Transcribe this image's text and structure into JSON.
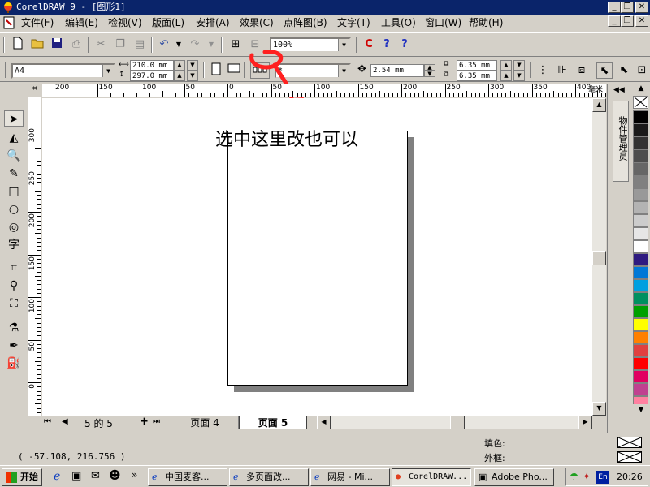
{
  "window": {
    "title": "CorelDRAW 9 - [图形1]",
    "min_glyph": "_",
    "restore_glyph": "❐",
    "close_glyph": "✕"
  },
  "menu": [
    "文件(F)",
    "编辑(E)",
    "检视(V)",
    "版面(L)",
    "安排(A)",
    "效果(C)",
    "点阵图(B)",
    "文字(T)",
    "工具(O)",
    "窗口(W)",
    "帮助(H)"
  ],
  "standard_toolbar": {
    "zoom": "100%",
    "icons": [
      "new-icon",
      "open-icon",
      "save-icon",
      "print-icon",
      "cut-icon",
      "copy-icon",
      "paste-icon",
      "undo-icon",
      "redo-icon",
      "import-icon",
      "export-icon",
      "corel-tutor-icon",
      "help-icon",
      "whats-this-icon"
    ]
  },
  "property_bar": {
    "paper": "A4",
    "width": "210.0 mm",
    "height": "297.0 mm",
    "units": "*",
    "nudge": "2.54 mm",
    "dup_x": "6.35 mm",
    "dup_y": "6.35 mm"
  },
  "annotation": {
    "text": "选中这里改也可以",
    "arrow_color": "#ff2020"
  },
  "rulers": {
    "h_labels": [
      "200",
      "150",
      "100",
      "50",
      "0",
      "50",
      "100",
      "150",
      "200",
      "250",
      "300",
      "350",
      "400"
    ],
    "h_unit": "毫米",
    "v_labels": [
      "300",
      "250",
      "200",
      "150",
      "100",
      "50",
      "0"
    ]
  },
  "page_nav": {
    "count_text": "5 的 5",
    "tabs": [
      "页面 4",
      "页面 5"
    ],
    "active_tab": "页面 5"
  },
  "docker": {
    "label": "物件管理员"
  },
  "palette": [
    "#000000",
    "#1a1a1a",
    "#333333",
    "#4d4d4d",
    "#666666",
    "#808080",
    "#999999",
    "#b3b3b3",
    "#cccccc",
    "#e6e6e6",
    "#ffffff",
    "#2e1a80",
    "#0078d7",
    "#00a0e0",
    "#009060",
    "#00a000",
    "#ffff00",
    "#ff8000",
    "#e04040",
    "#ff0000",
    "#e00060",
    "#c04090",
    "#ff80a0",
    "#f09000",
    "#f0a0a0",
    "#806040"
  ],
  "status": {
    "coords": "( -57.108, 216.756 )",
    "fill_label": "填色:",
    "outline_label": "外框:"
  },
  "taskbar": {
    "start": "开始",
    "tasks": [
      "中国麦客...",
      "多页面改...",
      "网易 - Mi...",
      "CorelDRAW...",
      "Adobe Pho..."
    ],
    "active_task": "CorelDRAW...",
    "lang": "En",
    "time": "20:26"
  }
}
